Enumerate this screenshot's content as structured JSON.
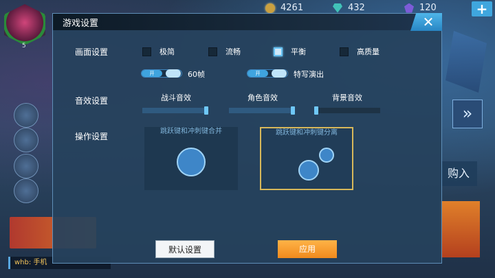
{
  "hud": {
    "gold": "4261",
    "gems": "432",
    "crystals": "120",
    "plus_label": "+",
    "player_level": "5"
  },
  "background": {
    "chat_text": "whb: 手机",
    "right_arrow": "»",
    "right_buy": "购入"
  },
  "dialog": {
    "title": "游戏设置",
    "close_label": "✕",
    "graphics": {
      "label": "画面设置",
      "options": [
        "极简",
        "流畅",
        "平衡",
        "高质量"
      ],
      "selected": "平衡",
      "toggles": [
        {
          "label": "60帧",
          "state": "开",
          "on": true
        },
        {
          "label": "特写演出",
          "state": "开",
          "on": true
        }
      ]
    },
    "audio": {
      "label": "音效设置",
      "sliders": [
        {
          "label": "战斗音效",
          "value": 0.97
        },
        {
          "label": "角色音效",
          "value": 0.97
        },
        {
          "label": "背景音效",
          "value": 0.03
        }
      ]
    },
    "controls": {
      "label": "操作设置",
      "options": [
        {
          "caption": "跳跃键和冲刺键合并",
          "selected": false
        },
        {
          "caption": "跳跃键和冲刺键分离",
          "selected": true
        }
      ]
    },
    "buttons": {
      "default_label": "默认设置",
      "apply_label": "应用"
    }
  },
  "colors": {
    "accent": "#3fa4df",
    "apply": "#f08a1d",
    "selected_border": "#d8b85a"
  }
}
